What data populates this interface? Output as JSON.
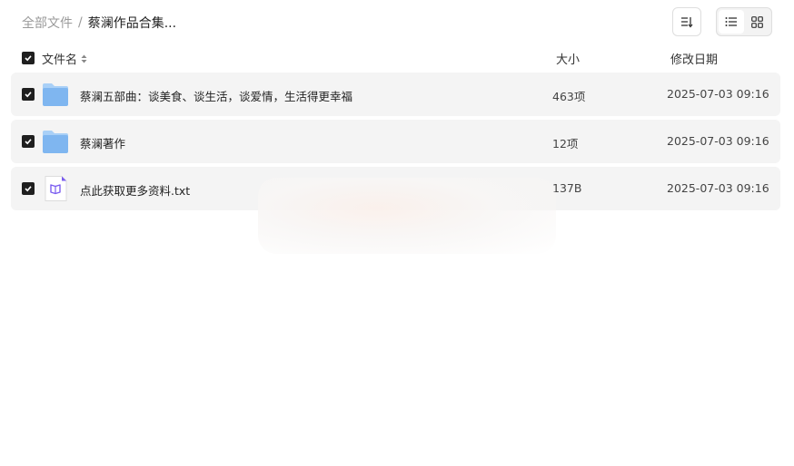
{
  "breadcrumb": {
    "root": "全部文件",
    "separator": "/",
    "current": "蔡澜作品合集..."
  },
  "toolbar": {
    "sort_icon": "sort-icon",
    "list_view_icon": "list-view-icon",
    "grid_view_icon": "grid-view-icon",
    "active_view": "list"
  },
  "columns": {
    "name": "文件名",
    "size": "大小",
    "date": "修改日期"
  },
  "files": [
    {
      "name": "蔡澜五部曲：谈美食、谈生活，谈爱情，生活得更幸福",
      "size": "463项",
      "date": "2025-07-03 09:16",
      "type": "folder",
      "checked": true
    },
    {
      "name": "蔡澜著作",
      "size": "12项",
      "date": "2025-07-03 09:16",
      "type": "folder",
      "checked": true
    },
    {
      "name": "点此获取更多资料.txt",
      "size": "137B",
      "date": "2025-07-03 09:16",
      "type": "txt",
      "checked": true
    }
  ],
  "colors": {
    "folder": "#7fb6f0",
    "folder_tab": "#a9d0f7",
    "txt_accent": "#7a5cf0",
    "row_bg": "#f4f4f4",
    "checkbox": "#1f1f1f"
  }
}
